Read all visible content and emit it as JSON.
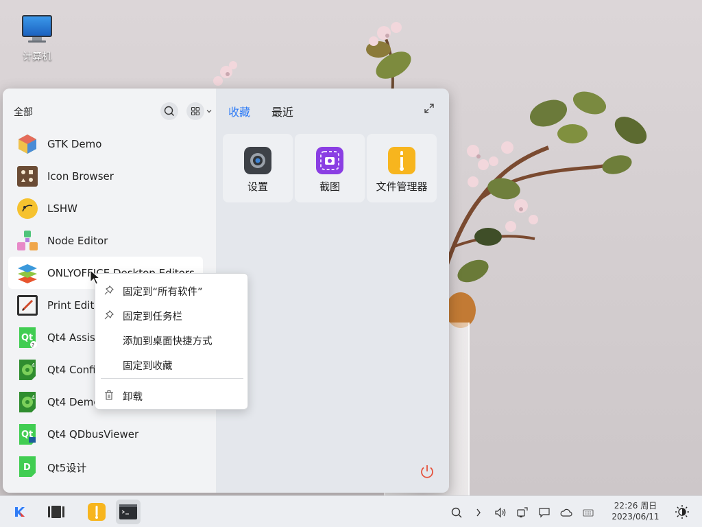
{
  "desktop": {
    "icons": [
      {
        "label": "计算机",
        "icon": "computer-icon"
      }
    ]
  },
  "start_menu": {
    "left": {
      "header": "全部",
      "apps": [
        {
          "label": "GTK Demo",
          "icon": "gtk-demo-icon"
        },
        {
          "label": "Icon Browser",
          "icon": "icon-browser-icon"
        },
        {
          "label": "LSHW",
          "icon": "lshw-icon"
        },
        {
          "label": "Node Editor",
          "icon": "node-editor-icon"
        },
        {
          "label": "ONLYOFFICE Desktop Editors",
          "icon": "onlyoffice-icon"
        },
        {
          "label": "Print Editor",
          "icon": "print-editor-icon"
        },
        {
          "label": "Qt4 Assistant",
          "icon": "qt4-assistant-icon"
        },
        {
          "label": "Qt4 Config",
          "icon": "qt4-config-icon"
        },
        {
          "label": "Qt4 Demo",
          "icon": "qt4-demo-icon"
        },
        {
          "label": "Qt4 QDbusViewer",
          "icon": "qt4-qdbusviewer-icon"
        },
        {
          "label": "Qt5设计",
          "icon": "qt5-designer-icon"
        }
      ]
    },
    "right": {
      "tabs": [
        {
          "label": "收藏",
          "active": true
        },
        {
          "label": "最近",
          "active": false
        }
      ],
      "favorites": [
        {
          "label": "设置",
          "icon": "settings-icon"
        },
        {
          "label": "截图",
          "icon": "screenshot-icon"
        },
        {
          "label": "文件管理器",
          "icon": "file-manager-icon"
        }
      ]
    }
  },
  "context_menu": {
    "items": [
      {
        "label": "固定到“所有软件”",
        "icon": "pin-icon"
      },
      {
        "label": "固定到任务栏",
        "icon": "pin-icon"
      },
      {
        "label": "添加到桌面快捷方式",
        "icon": ""
      },
      {
        "label": "固定到收藏",
        "icon": ""
      },
      {
        "label": "卸载",
        "icon": "trash-icon"
      }
    ]
  },
  "taskbar": {
    "clock": {
      "time": "22:26 周日",
      "date": "2023/06/11"
    }
  },
  "colors": {
    "accent": "#2f7cf6",
    "power": "#e5533d"
  }
}
